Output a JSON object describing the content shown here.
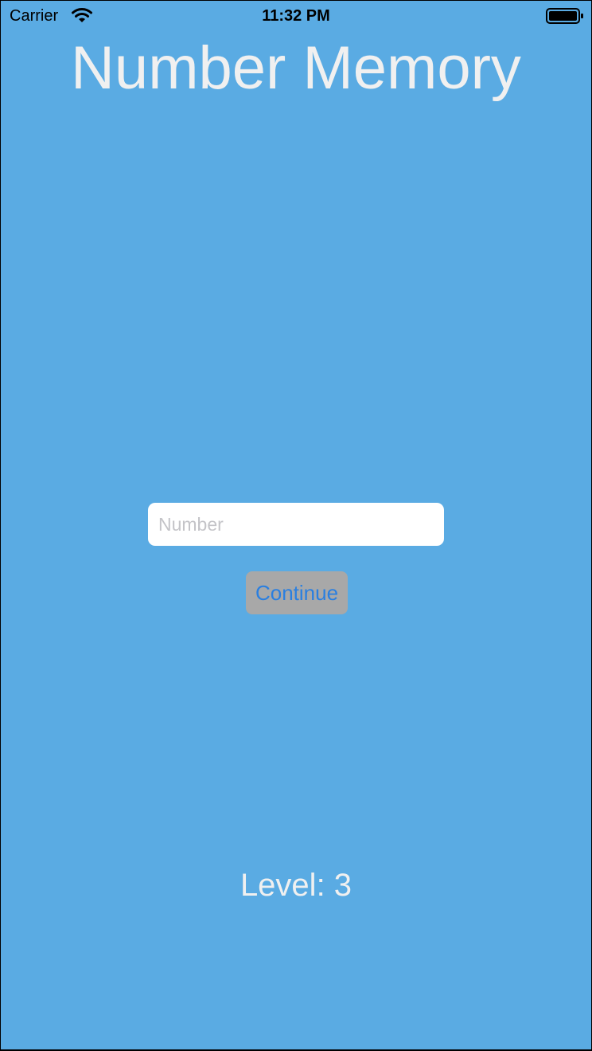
{
  "status_bar": {
    "carrier": "Carrier",
    "time": "11:32 PM",
    "icons": [
      "wifi-icon",
      "battery-icon"
    ]
  },
  "header": {
    "title": "Number Memory"
  },
  "form": {
    "number_placeholder": "Number",
    "number_value": "",
    "continue_label": "Continue"
  },
  "footer": {
    "level_text": "Level: 3"
  },
  "colors": {
    "background": "#5aabe3",
    "title_text": "#f0f0f0",
    "button_background": "#a8a8a8",
    "button_text": "#2a7fe0",
    "field_background": "#ffffff",
    "placeholder": "#c4c4c8"
  }
}
